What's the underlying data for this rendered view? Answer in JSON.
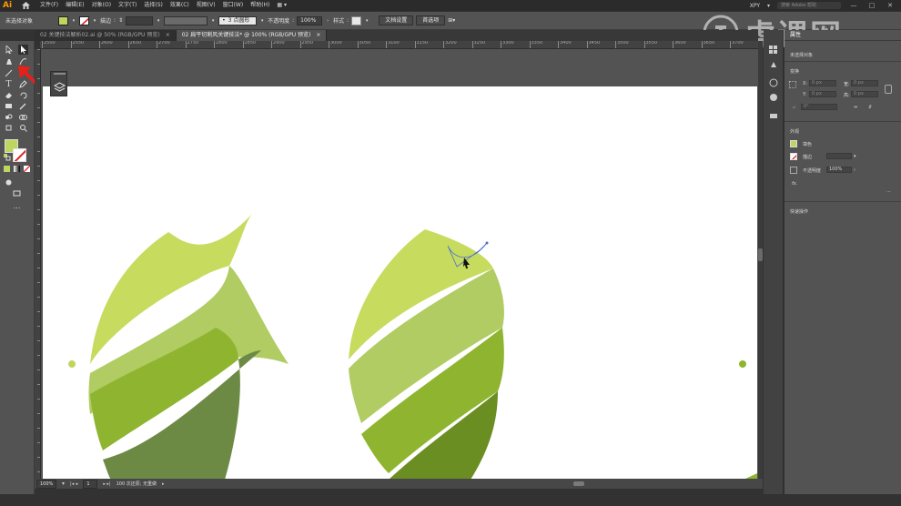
{
  "app": {
    "logo": "Ai",
    "workspace": "XPY",
    "search_placeholder": "搜索 Adobe 帮助"
  },
  "menu": [
    "文件(F)",
    "编辑(E)",
    "对象(O)",
    "文字(T)",
    "选择(S)",
    "效果(C)",
    "视图(V)",
    "窗口(W)",
    "帮助(H)"
  ],
  "control": {
    "selection_label": "未选择对象",
    "stroke_label": "描边",
    "stroke_weight": "",
    "brush_label": "3 点圆形",
    "opacity_label": "不透明度",
    "opacity_value": "100%",
    "style_label": "样式",
    "doc_setup": "文档设置",
    "preferences": "首选项"
  },
  "tabs": [
    {
      "label": "02 关键技法解析02.ai @ 50% (RGB/GPU 预览)",
      "close": "×"
    },
    {
      "label": "02 扁平切割风关键技法* @ 100% (RGB/GPU 预览)",
      "close": "×"
    }
  ],
  "ruler_labels": [
    "2500",
    "2550",
    "2600",
    "2650",
    "2700",
    "2750",
    "2800",
    "2850",
    "2900",
    "2950",
    "3000",
    "3050",
    "3100",
    "3150",
    "3200",
    "3250",
    "3300",
    "3350",
    "3400",
    "3450",
    "3500",
    "3550",
    "3600",
    "3650",
    "3700"
  ],
  "status": {
    "zoom": "100%",
    "page": "1",
    "info": "100 次还原; 无重做"
  },
  "properties": {
    "tab": "属性",
    "no_selection": "未选择对象",
    "transform": "变换",
    "x_label": "X:",
    "x_value": "0 px",
    "y_label": "Y:",
    "y_value": "0 px",
    "w_label": "宽:",
    "w_value": "0 px",
    "h_label": "高:",
    "h_value": "0 px",
    "angle": "0°",
    "appearance": "外观",
    "fill_label": "填色",
    "stroke_label": "描边",
    "opacity_label": "不透明度",
    "opacity_value": "100%",
    "fx": "fx.",
    "quick_actions": "快速操作"
  },
  "watermark": {
    "text": "虎课网"
  },
  "colors": {
    "leaf_light": "#c7db5e",
    "leaf_mid": "#b0cc63",
    "leaf_green": "#8fb530",
    "leaf_dark": "#6b8e23",
    "leaf_olive": "#6d8a45",
    "path_stroke": "#4a6fd1",
    "fill_swatch": "#bfd65e"
  }
}
